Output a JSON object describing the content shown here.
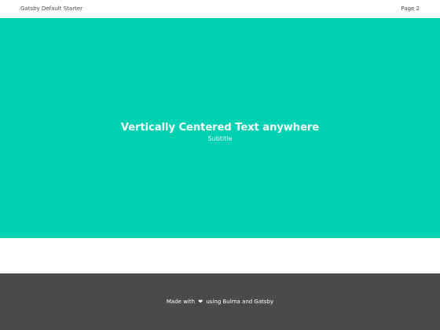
{
  "colors": {
    "hero_background": "#00d1b2",
    "footer_background": "#4a4a4a",
    "page_background": "#ffffff",
    "navbar_text": "#4a4a4a",
    "light_text": "#ffffff"
  },
  "navbar": {
    "brand": "Gatsby Default Starter",
    "link": "Page 2"
  },
  "hero": {
    "title": "Vertically Centered Text anywhere",
    "subtitle": "Subtitle"
  },
  "footer": {
    "prefix": "Made with",
    "heart_icon": "heart-icon",
    "heart_glyph": "❤",
    "suffix": "using Bulma and Gatsby"
  }
}
